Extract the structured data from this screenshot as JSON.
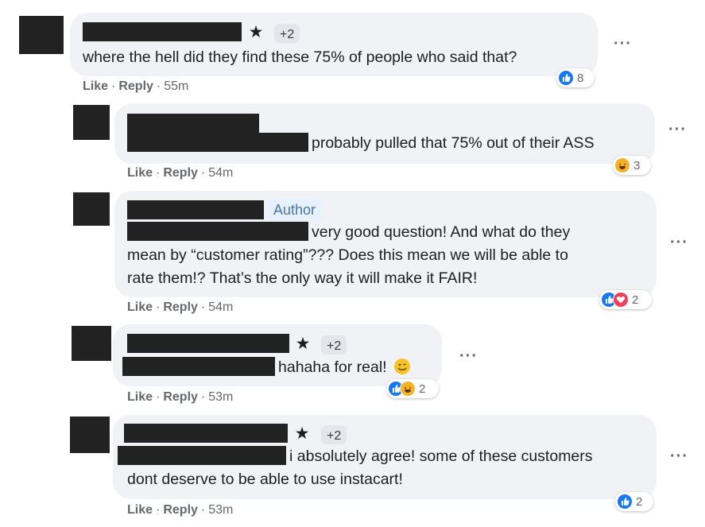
{
  "comments": [
    {
      "badge": "+2",
      "text": "where the hell did they find these 75% of people who said that?",
      "like": "Like",
      "reply": "Reply",
      "time": "55m",
      "reaction_count": "8",
      "reactions": [
        "like"
      ]
    },
    {
      "text": "probably pulled that 75% out of their ASS",
      "like": "Like",
      "reply": "Reply",
      "time": "54m",
      "reaction_count": "3",
      "reactions": [
        "haha"
      ]
    },
    {
      "author_badge": "Author",
      "text_line1": "very good question! And what do they",
      "text_line2": "mean by “customer rating”??? Does this mean we will be able to",
      "text_line3": "rate them!? That’s the only way it will make it FAIR!",
      "like": "Like",
      "reply": "Reply",
      "time": "54m",
      "reaction_count": "2",
      "reactions": [
        "like",
        "love"
      ]
    },
    {
      "badge": "+2",
      "text": "hahaha for real!",
      "like": "Like",
      "reply": "Reply",
      "time": "53m",
      "reaction_count": "2",
      "reactions": [
        "like",
        "haha"
      ]
    },
    {
      "badge": "+2",
      "text_line1": "i absolutely agree! some of these customers",
      "text_line2": "dont deserve to be able to use instacart!",
      "like": "Like",
      "reply": "Reply",
      "time": "53m",
      "reaction_count": "2",
      "reactions": [
        "like"
      ]
    }
  ],
  "more_label": "···",
  "separator": "·",
  "colors": {
    "bubble": "#f0f2f5",
    "redaction": "#222222",
    "like": "#1877f2",
    "love": "#f33e58",
    "haha": "#f7b125",
    "meta_text": "#65676b"
  }
}
